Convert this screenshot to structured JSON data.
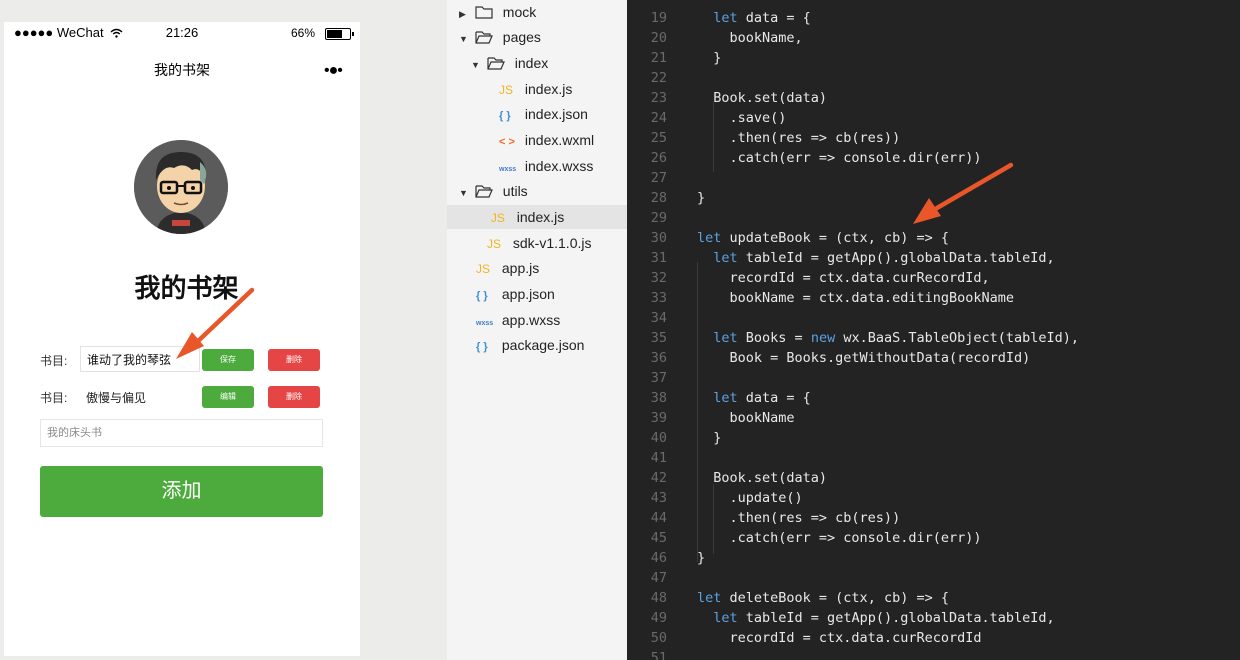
{
  "phone": {
    "carrier": "●●●●● WeChat",
    "time": "21:26",
    "battery": "66%",
    "nav_title": "我的书架",
    "nav_menu": "•●•",
    "heading": "我的书架",
    "books": [
      {
        "label": "书目:",
        "value": "谁动了我的琴弦",
        "primary_button": "保存",
        "delete_button": "删除"
      },
      {
        "label": "书目:",
        "value": "傲慢与偏见",
        "primary_button": "编辑",
        "delete_button": "删除"
      }
    ],
    "new_book_placeholder": "我的床头书",
    "add_button": "添加"
  },
  "file_tree": [
    {
      "name": "mock",
      "type": "folder",
      "expanded": false
    },
    {
      "name": "pages",
      "type": "folder",
      "expanded": true
    },
    {
      "name": "index",
      "type": "folder",
      "expanded": true
    },
    {
      "name": "index.js",
      "type": "JS"
    },
    {
      "name": "index.json",
      "type": "{ }"
    },
    {
      "name": "index.wxml",
      "type": "< >"
    },
    {
      "name": "index.wxss",
      "type": "wxss"
    },
    {
      "name": "utils",
      "type": "folder",
      "expanded": true
    },
    {
      "name": "index.js",
      "type": "JS",
      "selected": true
    },
    {
      "name": "sdk-v1.1.0.js",
      "type": "JS"
    },
    {
      "name": "app.js",
      "type": "JS"
    },
    {
      "name": "app.json",
      "type": "{ }"
    },
    {
      "name": "app.wxss",
      "type": "wxss"
    },
    {
      "name": "package.json",
      "type": "{ }"
    }
  ],
  "editor": {
    "lines": [
      {
        "n": "19",
        "code": "  let data = {"
      },
      {
        "n": "20",
        "code": "    bookName,"
      },
      {
        "n": "21",
        "code": "  }"
      },
      {
        "n": "22",
        "code": ""
      },
      {
        "n": "23",
        "code": "  Book.set(data)"
      },
      {
        "n": "24",
        "code": "    .save()"
      },
      {
        "n": "25",
        "code": "    .then(res => cb(res))"
      },
      {
        "n": "26",
        "code": "    .catch(err => console.dir(err))"
      },
      {
        "n": "27",
        "code": ""
      },
      {
        "n": "28",
        "code": "}"
      },
      {
        "n": "29",
        "code": ""
      },
      {
        "n": "30",
        "code": "let updateBook = (ctx, cb) => {"
      },
      {
        "n": "31",
        "code": "  let tableId = getApp().globalData.tableId,"
      },
      {
        "n": "32",
        "code": "    recordId = ctx.data.curRecordId,"
      },
      {
        "n": "33",
        "code": "    bookName = ctx.data.editingBookName"
      },
      {
        "n": "34",
        "code": ""
      },
      {
        "n": "35",
        "code": "  let Books = new wx.BaaS.TableObject(tableId),"
      },
      {
        "n": "36",
        "code": "    Book = Books.getWithoutData(recordId)"
      },
      {
        "n": "37",
        "code": ""
      },
      {
        "n": "38",
        "code": "  let data = {"
      },
      {
        "n": "39",
        "code": "    bookName"
      },
      {
        "n": "40",
        "code": "  }"
      },
      {
        "n": "41",
        "code": ""
      },
      {
        "n": "42",
        "code": "  Book.set(data)"
      },
      {
        "n": "43",
        "code": "    .update()"
      },
      {
        "n": "44",
        "code": "    .then(res => cb(res))"
      },
      {
        "n": "45",
        "code": "    .catch(err => console.dir(err))"
      },
      {
        "n": "46",
        "code": "}"
      },
      {
        "n": "47",
        "code": ""
      },
      {
        "n": "48",
        "code": "let deleteBook = (ctx, cb) => {"
      },
      {
        "n": "49",
        "code": "  let tableId = getApp().globalData.tableId,"
      },
      {
        "n": "50",
        "code": "    recordId = ctx.data.curRecordId"
      },
      {
        "n": "51",
        "code": ""
      }
    ]
  },
  "colors": {
    "accent_green": "#4cab3c",
    "danger_red": "#e54545",
    "annotation_arrow": "#e8562a",
    "editor_bg": "#232323",
    "keyword": "#5ba1e0"
  }
}
